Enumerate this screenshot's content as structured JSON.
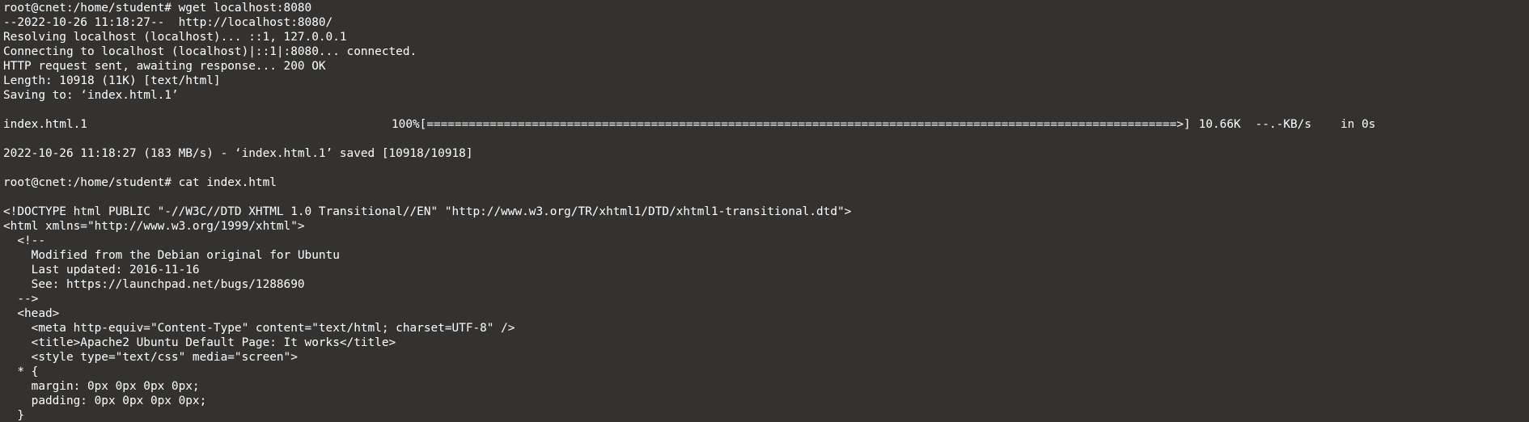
{
  "window": {
    "background": "#333231",
    "foreground": "#ffffff"
  },
  "session": {
    "prompt1": "root@cnet:/home/student# wget localhost:8080",
    "wget_output": [
      "--2022-10-26 11:18:27--  http://localhost:8080/",
      "Resolving localhost (localhost)... ::1, 127.0.0.1",
      "Connecting to localhost (localhost)|::1|:8080... connected.",
      "HTTP request sent, awaiting response... 200 OK",
      "Length: 10918 (11K) [text/html]",
      "Saving to: ‘index.html.1’"
    ],
    "progress": {
      "filename": "index.html.1",
      "percent": "100%",
      "bar": "[===========================================================================================================>]",
      "size": "10.66K",
      "rate": "--.-KB/s",
      "eta": "in 0s"
    },
    "saved_line": "2022-10-26 11:18:27 (183 MB/s) - ‘index.html.1’ saved [10918/10918]",
    "prompt2": "root@cnet:/home/student# cat index.html",
    "cat_output": [
      "<!DOCTYPE html PUBLIC \"-//W3C//DTD XHTML 1.0 Transitional//EN\" \"http://www.w3.org/TR/xhtml1/DTD/xhtml1-transitional.dtd\">",
      "<html xmlns=\"http://www.w3.org/1999/xhtml\">",
      "  <!--",
      "    Modified from the Debian original for Ubuntu",
      "    Last updated: 2016-11-16",
      "    See: https://launchpad.net/bugs/1288690",
      "  -->",
      "  <head>",
      "    <meta http-equiv=\"Content-Type\" content=\"text/html; charset=UTF-8\" />",
      "    <title>Apache2 Ubuntu Default Page: It works</title>",
      "    <style type=\"text/css\" media=\"screen\">",
      "  * {",
      "    margin: 0px 0px 0px 0px;",
      "    padding: 0px 0px 0px 0px;",
      "  }"
    ]
  }
}
